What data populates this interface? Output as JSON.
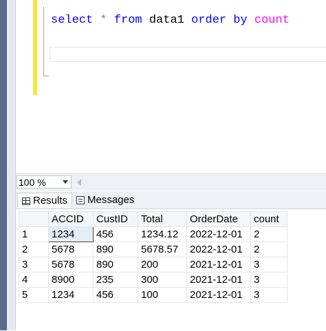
{
  "editor": {
    "query": {
      "kw1": "select",
      "star": "*",
      "kw2": "from",
      "table": "data1",
      "kw3": "order by",
      "col": "count"
    }
  },
  "zoom": {
    "value": "100 %"
  },
  "tabs": {
    "results": "Results",
    "messages": "Messages"
  },
  "grid": {
    "headers": [
      "ACCID",
      "CustID",
      "Total",
      "OrderDate",
      "count"
    ],
    "rows": [
      [
        "1",
        "1234",
        "456",
        "1234.12",
        "2022-12-01",
        "2"
      ],
      [
        "2",
        "5678",
        "890",
        "5678.57",
        "2022-12-01",
        "2"
      ],
      [
        "3",
        "5678",
        "890",
        "200",
        "2021-12-01",
        "3"
      ],
      [
        "4",
        "8900",
        "235",
        "300",
        "2021-12-01",
        "3"
      ],
      [
        "5",
        "1234",
        "456",
        "100",
        "2021-12-01",
        "3"
      ]
    ]
  },
  "colors": {
    "keyword": "#0000ff",
    "function": "#ff00ff",
    "marker": "#f5e642"
  },
  "icons": {
    "results_tab": "grid-icon",
    "messages_tab": "messages-icon",
    "zoom_dropdown": "chevron-down-icon"
  }
}
